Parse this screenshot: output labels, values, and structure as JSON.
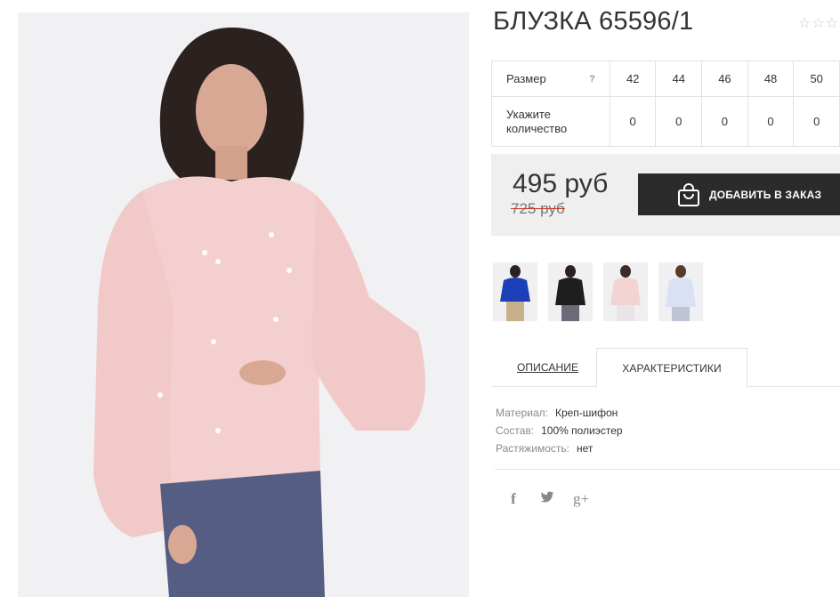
{
  "product": {
    "title": "БЛУЗКА 65596/1",
    "rating_stars": "☆☆☆☆☆",
    "rating_value": 0
  },
  "sizes": {
    "header_label": "Размер",
    "help_icon": "?",
    "qty_label": "Укажите количество",
    "items": [
      {
        "size": "42",
        "qty": "0"
      },
      {
        "size": "44",
        "qty": "0"
      },
      {
        "size": "46",
        "qty": "0"
      },
      {
        "size": "48",
        "qty": "0"
      },
      {
        "size": "50",
        "qty": "0"
      }
    ]
  },
  "price": {
    "current": "495 руб",
    "old": "725 руб"
  },
  "order_button": {
    "label": "ДОБАВИТЬ В ЗАКАЗ",
    "icon": "shopping-bag-icon"
  },
  "thumbnails": [
    {
      "name": "blue",
      "color": "#1c3fb8"
    },
    {
      "name": "black",
      "color": "#1e1e1e"
    },
    {
      "name": "pink",
      "color": "#f3d3d3"
    },
    {
      "name": "light-blue",
      "color": "#d9e2f4"
    }
  ],
  "tabs": {
    "description": "ОПИСАНИЕ",
    "characteristics": "ХАРАКТЕРИСТИКИ"
  },
  "characteristics": [
    {
      "key": "Материал:",
      "value": "Креп-шифон"
    },
    {
      "key": "Состав:",
      "value": "100% полиэстер"
    },
    {
      "key": "Растяжимость:",
      "value": "нет"
    }
  ],
  "social": {
    "facebook": "f",
    "twitter": "twitter-icon",
    "googleplus": "g+"
  },
  "colors": {
    "blouse": "#f4cfcf",
    "button_bg": "#2b2b2b",
    "price_bg": "#efefef"
  }
}
